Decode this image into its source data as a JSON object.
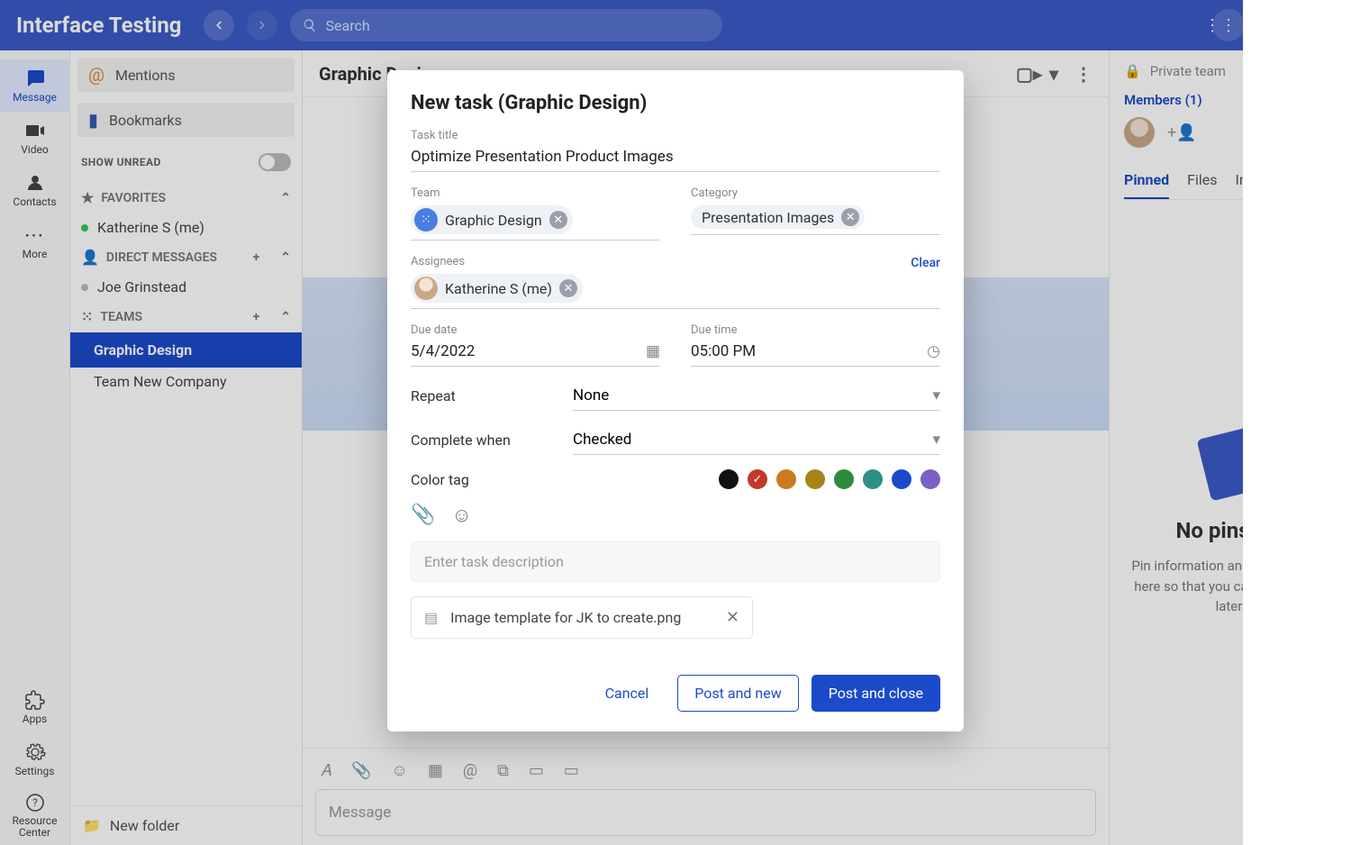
{
  "brand": "Interface Testing",
  "search": {
    "placeholder": "Search"
  },
  "rail": {
    "message": "Message",
    "video": "Video",
    "contacts": "Contacts",
    "more": "More",
    "apps": "Apps",
    "settings": "Settings",
    "resource": "Resource Center"
  },
  "sidebar": {
    "mentions": "Mentions",
    "bookmarks": "Bookmarks",
    "show_unread": "SHOW UNREAD",
    "favorites": "FAVORITES",
    "fav_items": [
      "Katherine S (me)"
    ],
    "direct": "DIRECT MESSAGES",
    "dm_items": [
      "Joe Grinstead"
    ],
    "teams_label": "TEAMS",
    "teams": [
      "Graphic Design",
      "Team New Company"
    ],
    "selected_team_index": 0,
    "new_folder": "New folder"
  },
  "center": {
    "title": "Graphic Design",
    "message_placeholder": "Message"
  },
  "right": {
    "private": "Private team",
    "members": "Members (1)",
    "tabs": [
      "Pinned",
      "Files",
      "Images"
    ],
    "active_tab": 0,
    "empty_title": "No pins yet",
    "empty_body": "Pin information and it will appear here so that you can reference it later."
  },
  "modal": {
    "title": "New task (Graphic Design)",
    "task_title_label": "Task title",
    "task_title": "Optimize Presentation Product Images",
    "team_label": "Team",
    "team_chip": "Graphic Design",
    "category_label": "Category",
    "category_chip": "Presentation Images",
    "assignees_label": "Assignees",
    "assignee_chip": "Katherine S (me)",
    "clear": "Clear",
    "due_date_label": "Due date",
    "due_date": "5/4/2022",
    "due_time_label": "Due time",
    "due_time": "05:00 PM",
    "repeat_label": "Repeat",
    "repeat_value": "None",
    "complete_label": "Complete when",
    "complete_value": "Checked",
    "color_label": "Color tag",
    "colors": [
      "#111111",
      "#c0392b",
      "#ca7b1e",
      "#a88318",
      "#2e8b3d",
      "#2f8f87",
      "#1b4acb",
      "#7a5fc4"
    ],
    "selected_color_index": 1,
    "desc_placeholder": "Enter task description",
    "attachment": "Image template for JK to create.png",
    "cancel": "Cancel",
    "post_new": "Post and new",
    "post_close": "Post and close"
  }
}
